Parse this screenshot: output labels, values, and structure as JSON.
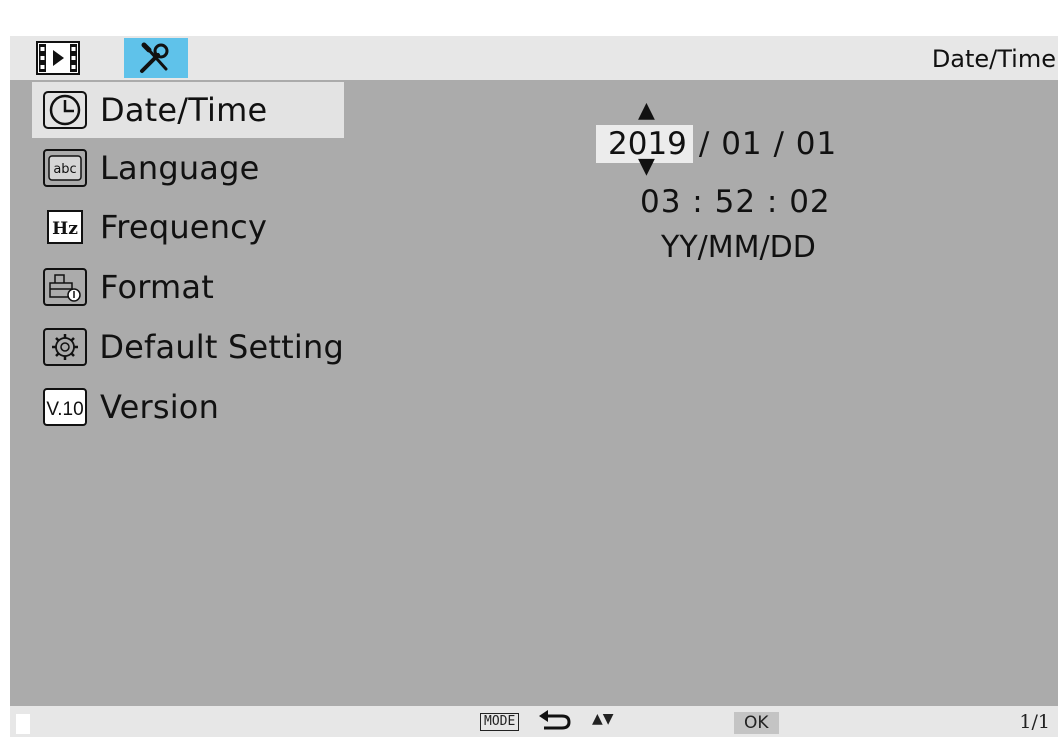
{
  "header": {
    "tabs": [
      {
        "name": "playback",
        "icon": "film-play-icon",
        "selected": false
      },
      {
        "name": "settings",
        "icon": "wrench-screwdriver-icon",
        "selected": true
      }
    ],
    "title": "Date/Time",
    "accent_color": "#5fc2ea"
  },
  "menu": {
    "items": [
      {
        "label": "Date/Time",
        "icon": "clock-icon",
        "selected": true
      },
      {
        "label": "Language",
        "icon": "abc-icon",
        "selected": false
      },
      {
        "label": "Frequency",
        "icon": "hz-icon",
        "selected": false
      },
      {
        "label": "Format",
        "icon": "sd-card-format-icon",
        "selected": false
      },
      {
        "label": "Default Setting",
        "icon": "gear-icon",
        "selected": false
      },
      {
        "label": "Version",
        "icon": "version-icon",
        "icon_text": "V.10",
        "selected": false
      }
    ]
  },
  "datetime": {
    "year": "2019",
    "date_rest": "/ 01 / 01",
    "time": "03 : 52 : 02",
    "format": "YY/MM/DD",
    "up_arrow": "▲",
    "down_arrow": "▼"
  },
  "footer": {
    "mode_label": "MODE",
    "updown_label": "▲▼",
    "ok_label": "OK",
    "page": "1/1"
  },
  "colors": {
    "background": "#ababab",
    "bar": "#e7e7e7",
    "highlight": "#e3e3e3"
  }
}
